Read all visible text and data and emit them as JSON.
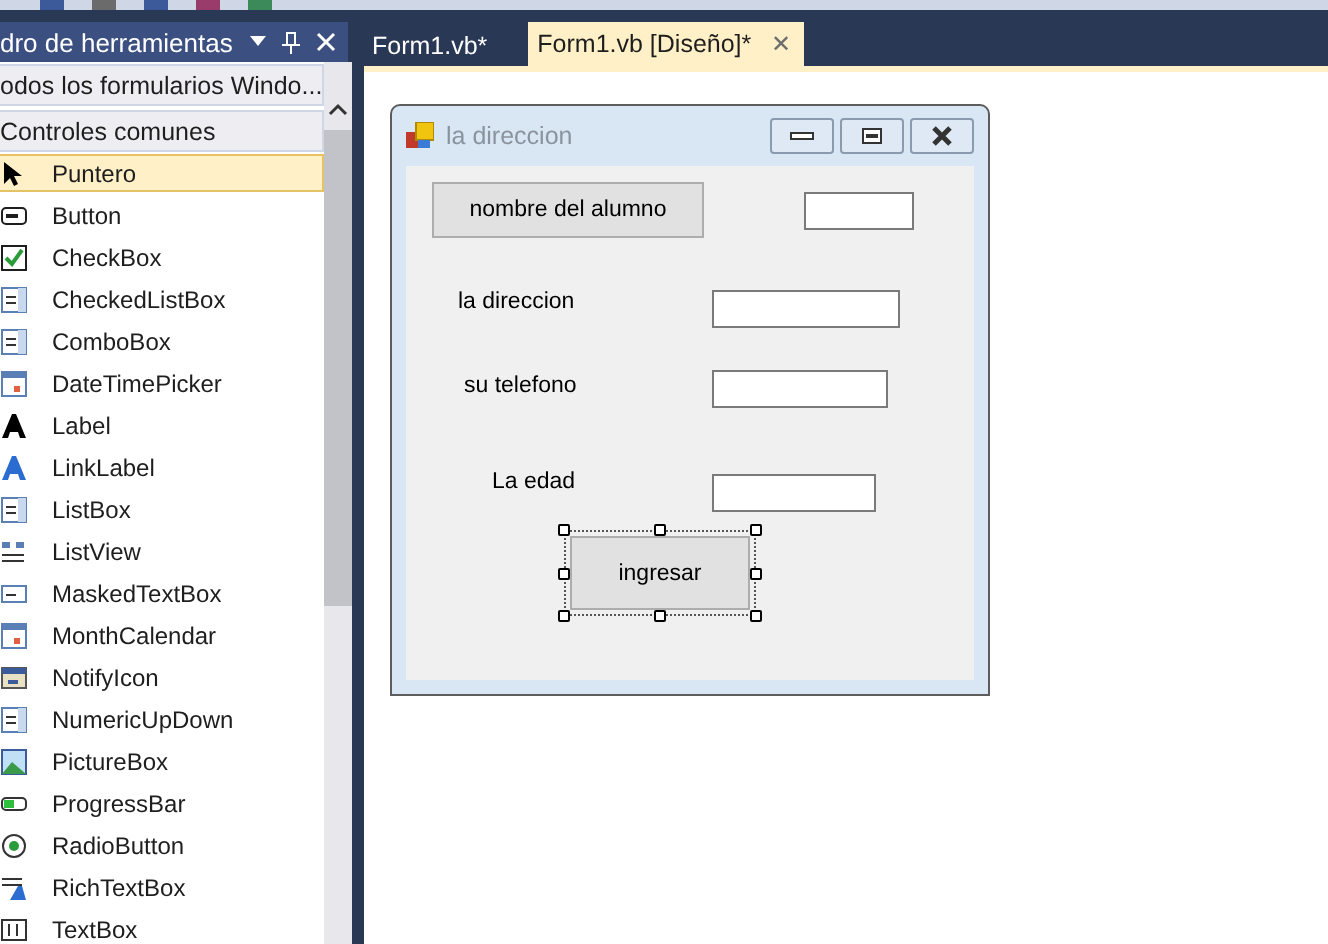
{
  "toolbox": {
    "title": "dro de herramientas",
    "groups": [
      {
        "label": "odos los formularios Windo..."
      },
      {
        "label": "Controles comunes"
      }
    ],
    "items": [
      {
        "label": "Puntero",
        "kind": "pointer",
        "selected": true
      },
      {
        "label": "Button",
        "kind": "button",
        "selected": false
      },
      {
        "label": "CheckBox",
        "kind": "checkbox",
        "selected": false
      },
      {
        "label": "CheckedListBox",
        "kind": "list",
        "selected": false
      },
      {
        "label": "ComboBox",
        "kind": "combo",
        "selected": false
      },
      {
        "label": "DateTimePicker",
        "kind": "calendar",
        "selected": false
      },
      {
        "label": "Label",
        "kind": "label",
        "selected": false
      },
      {
        "label": "LinkLabel",
        "kind": "link",
        "selected": false
      },
      {
        "label": "ListBox",
        "kind": "list",
        "selected": false
      },
      {
        "label": "ListView",
        "kind": "listview",
        "selected": false
      },
      {
        "label": "MaskedTextBox",
        "kind": "masked",
        "selected": false
      },
      {
        "label": "MonthCalendar",
        "kind": "calendar",
        "selected": false
      },
      {
        "label": "NotifyIcon",
        "kind": "notify",
        "selected": false
      },
      {
        "label": "NumericUpDown",
        "kind": "list",
        "selected": false
      },
      {
        "label": "PictureBox",
        "kind": "picture",
        "selected": false
      },
      {
        "label": "ProgressBar",
        "kind": "progress",
        "selected": false
      },
      {
        "label": "RadioButton",
        "kind": "radio",
        "selected": false
      },
      {
        "label": "RichTextBox",
        "kind": "rich",
        "selected": false
      },
      {
        "label": "TextBox",
        "kind": "textbox",
        "selected": false
      }
    ]
  },
  "tabs": [
    {
      "label": "Form1.vb*",
      "selected": false
    },
    {
      "label": "Form1.vb [Diseño]*",
      "selected": true,
      "close": "✕"
    }
  ],
  "form": {
    "title": "la direccion",
    "controls": [
      {
        "kind": "button",
        "text": "nombre del alumno",
        "selected": false
      },
      {
        "kind": "textbox",
        "selected": false
      },
      {
        "kind": "label",
        "text": "la direccion",
        "selected": false
      },
      {
        "kind": "textbox",
        "selected": false
      },
      {
        "kind": "label",
        "text": "su telefono",
        "selected": false
      },
      {
        "kind": "textbox",
        "selected": false
      },
      {
        "kind": "label",
        "text": "La edad",
        "selected": false
      },
      {
        "kind": "textbox",
        "selected": false
      },
      {
        "kind": "button",
        "text": "ingresar",
        "selected": true
      }
    ]
  }
}
